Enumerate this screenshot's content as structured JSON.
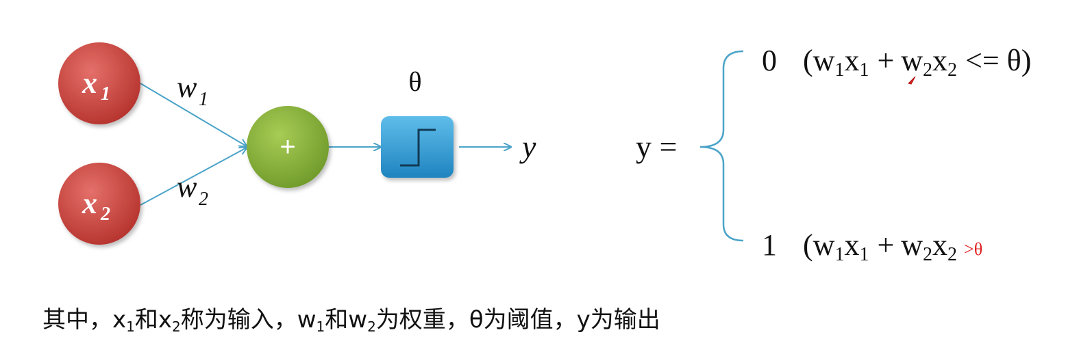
{
  "diagram": {
    "inputs": [
      {
        "var": "x",
        "sub": "1"
      },
      {
        "var": "x",
        "sub": "2"
      }
    ],
    "weights": [
      {
        "var": "w",
        "sub": "1"
      },
      {
        "var": "w",
        "sub": "2"
      }
    ],
    "sum_symbol": "+",
    "threshold_label": "θ",
    "output_label": "y"
  },
  "formula": {
    "lhs": "y =",
    "case_0": {
      "value": "0",
      "open": "(",
      "w1": "w",
      "w1_sub": "1",
      "x1": "x",
      "x1_sub": "1",
      "plus": "+",
      "w2": "w",
      "w2_sub": "2",
      "x2": "x",
      "x2_sub": "2",
      "condition": "<= θ)"
    },
    "case_1": {
      "value": "1",
      "open": "(",
      "w1": "w",
      "w1_sub": "1",
      "x1": "x",
      "x1_sub": "1",
      "plus": "+",
      "w2": "w",
      "w2_sub": "2",
      "x2": "x",
      "x2_sub": "2",
      "condition": ">θ"
    }
  },
  "caption": {
    "prefix": "其中，",
    "x": "x",
    "x1_sub": "1",
    "and1": "和",
    "x2_sub": "2",
    "inputs_text": "称为输入，",
    "w": "w",
    "w1_sub": "1",
    "and2": "和",
    "w2_sub": "2",
    "weights_text": "为权重，",
    "theta": "θ",
    "threshold_text": "为阈值，",
    "y": "y",
    "output_text": "为输出"
  },
  "colors": {
    "input_node": "#c8403a",
    "sum_node": "#8ab33a",
    "step_box": "#2e9ad4",
    "arrow": "#4aa3c8",
    "brace": "#4aa3c8",
    "annotation": "#e02020"
  }
}
